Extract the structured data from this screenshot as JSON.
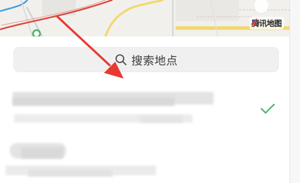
{
  "map": {
    "provider_label": "腾讯地图"
  },
  "search": {
    "placeholder": "搜索地点"
  },
  "locations": [
    {
      "name": "",
      "address": "",
      "selected": true
    },
    {
      "name": "",
      "address": "",
      "selected": false
    }
  ],
  "colors": {
    "accent_green": "#45b36b",
    "annotation_red": "#e8382f",
    "route_red": "#d9453b"
  },
  "icons": {
    "search": "search-icon",
    "check": "check-icon",
    "logo": "tencent-map-logo-icon"
  }
}
